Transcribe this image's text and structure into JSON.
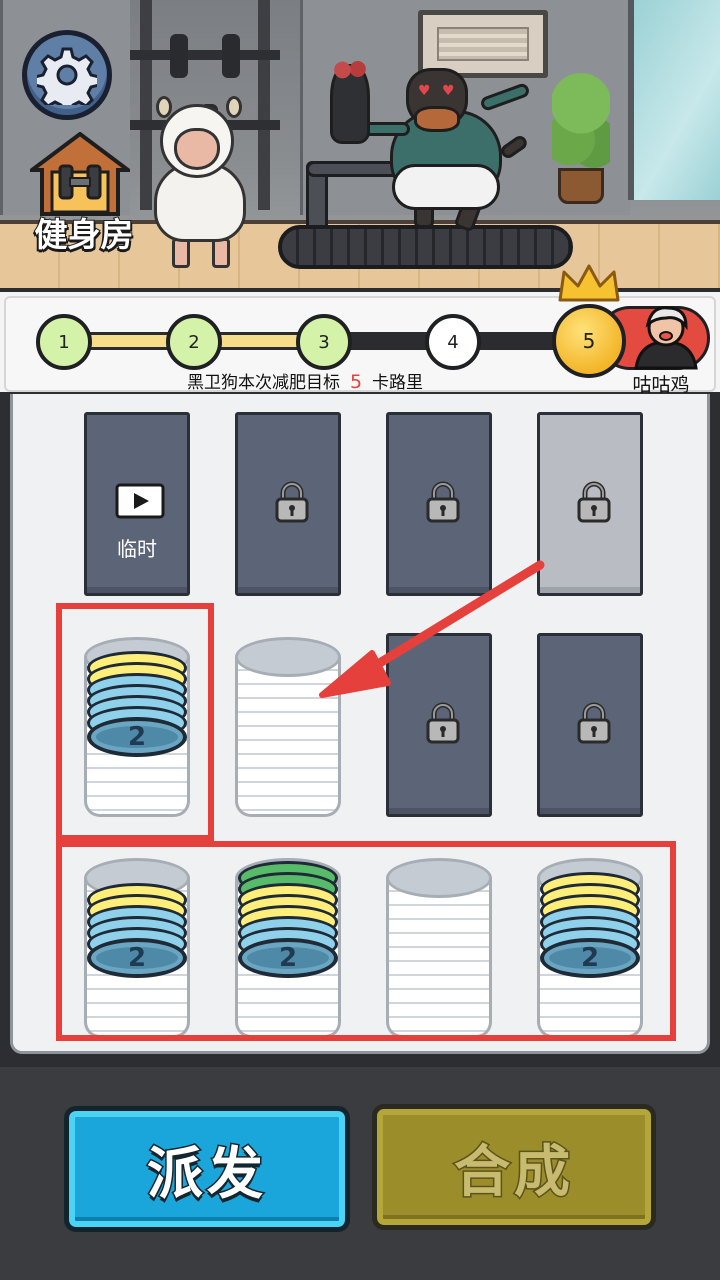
{
  "scene": {
    "gym_label": "健身房",
    "characters": [
      "sheep",
      "black-dog"
    ]
  },
  "progress": {
    "milestones": [
      {
        "label": "1",
        "state": "done"
      },
      {
        "label": "2",
        "state": "done"
      },
      {
        "label": "3",
        "state": "done"
      },
      {
        "label": "4",
        "state": "todo"
      }
    ],
    "final_milestone": "5",
    "current_level": 3,
    "total_levels": 5,
    "boss_name": "咕咕鸡",
    "goal_prefix": "黑卫狗本次减肥目标",
    "goal_value": "5",
    "goal_suffix": "卡路里"
  },
  "board": {
    "temp_slot_label": "临时",
    "slots": [
      {
        "row": 0,
        "col": 0,
        "type": "temp"
      },
      {
        "row": 0,
        "col": 1,
        "type": "locked"
      },
      {
        "row": 0,
        "col": 2,
        "type": "locked"
      },
      {
        "row": 0,
        "col": 3,
        "type": "locked"
      },
      {
        "row": 1,
        "col": 0,
        "type": "stack",
        "discs": [
          "yellow",
          "yellow",
          "blue",
          "blue",
          "blue",
          "blue"
        ],
        "label": "2"
      },
      {
        "row": 1,
        "col": 1,
        "type": "empty"
      },
      {
        "row": 1,
        "col": 2,
        "type": "locked"
      },
      {
        "row": 1,
        "col": 3,
        "type": "locked"
      },
      {
        "row": 2,
        "col": 0,
        "type": "stack",
        "discs": [
          "yellow",
          "yellow",
          "blue",
          "blue",
          "blue"
        ],
        "label": "2"
      },
      {
        "row": 2,
        "col": 1,
        "type": "stack",
        "discs": [
          "green",
          "green",
          "yellow",
          "yellow",
          "yellow",
          "blue",
          "blue"
        ],
        "label": "2"
      },
      {
        "row": 2,
        "col": 2,
        "type": "empty"
      },
      {
        "row": 2,
        "col": 3,
        "type": "stack",
        "discs": [
          "yellow",
          "yellow",
          "yellow",
          "blue",
          "blue",
          "blue"
        ],
        "label": "2"
      }
    ],
    "colors": {
      "yellow": "#ffef7a",
      "blue": "#8fd0ea",
      "green": "#58bb6a",
      "highlight": "#e6403c"
    }
  },
  "buttons": {
    "dispatch_label": "派发",
    "merge_label": "合成",
    "merge_enabled": false
  },
  "icons": [
    "gear-icon",
    "gym-house-icon",
    "video-icon",
    "lock-icon",
    "crown-icon",
    "arrow-icon"
  ]
}
